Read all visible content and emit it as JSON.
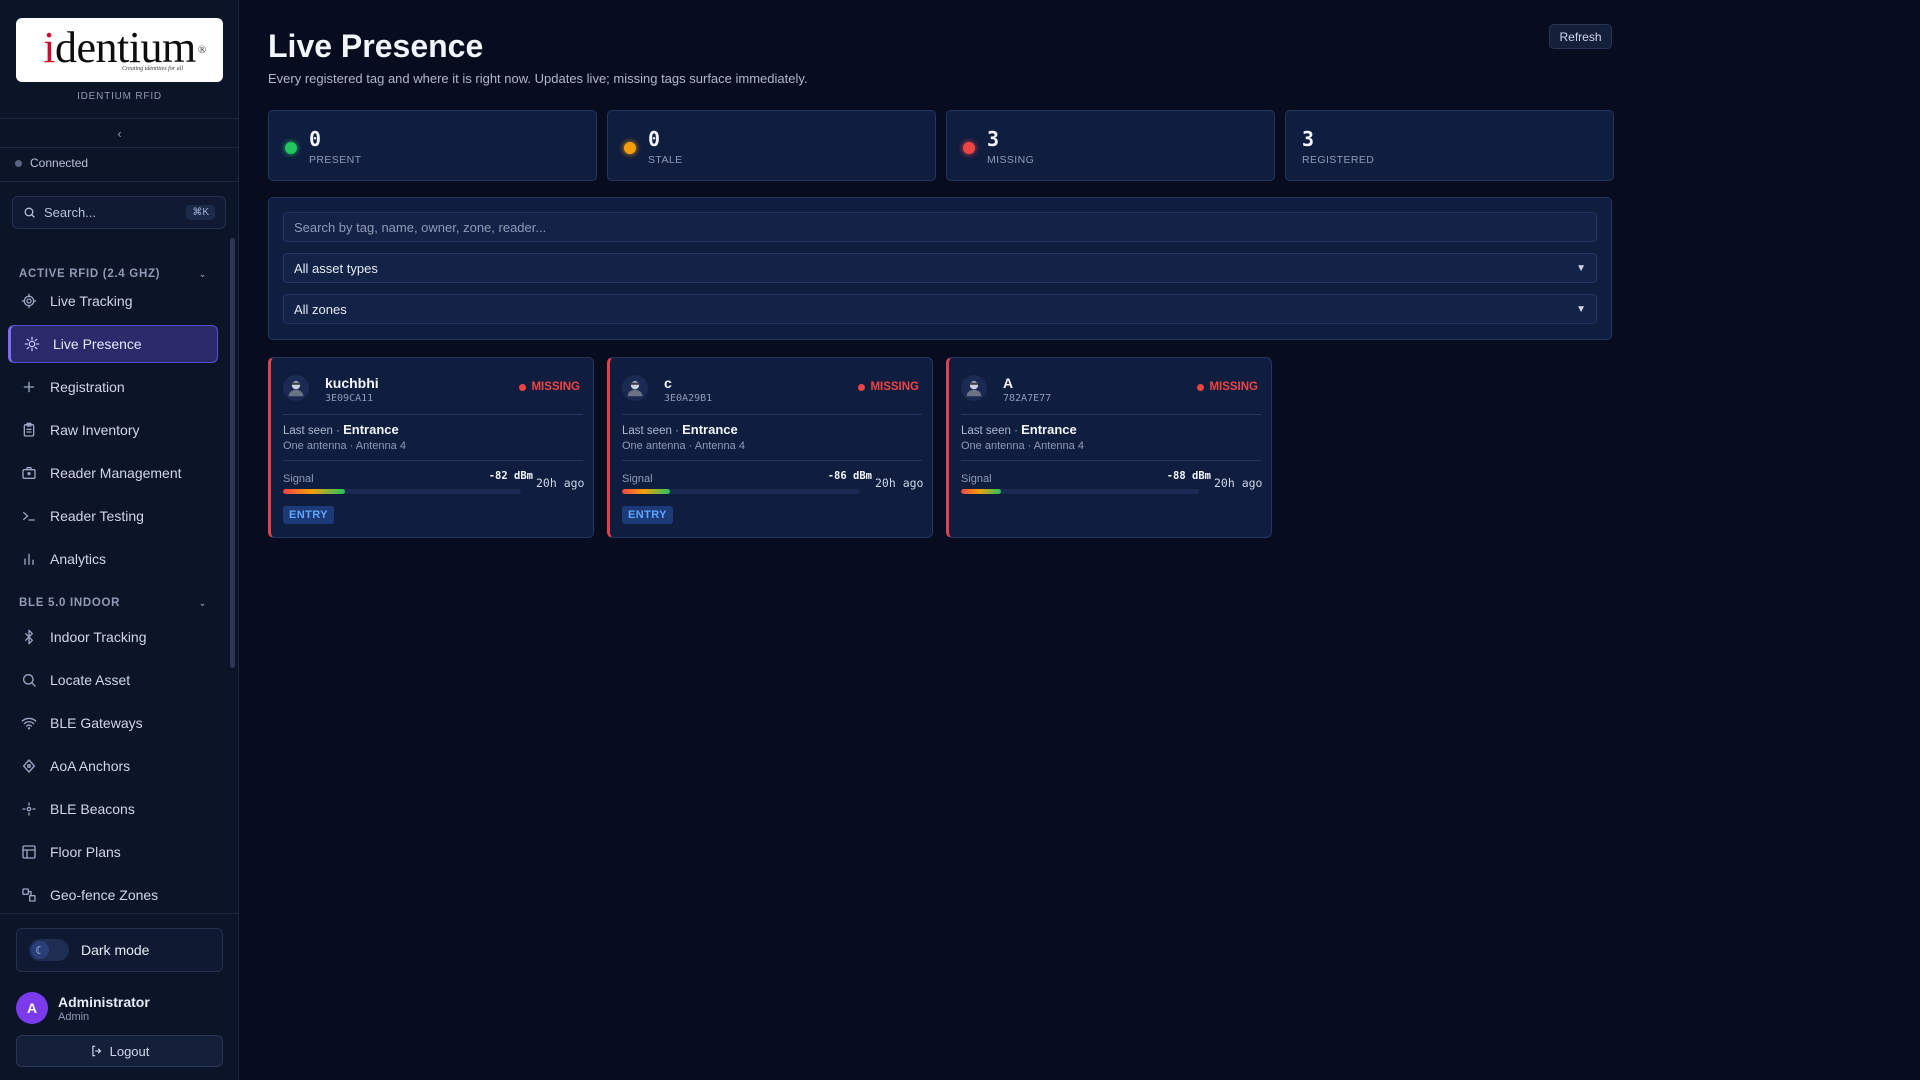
{
  "brand": {
    "logo_text_i": "i",
    "logo_text_rest": "dentium",
    "logo_reg": "®",
    "logo_tagline": "Creating identities for all",
    "label": "IDENTIUM RFID"
  },
  "sidebar": {
    "collapse_glyph": "‹",
    "connection_status": "Connected",
    "search": {
      "placeholder": "Search...",
      "shortcut": "⌘K"
    },
    "sections": [
      {
        "title": "ACTIVE RFID (2.4 GHZ)",
        "items": [
          {
            "label": "Live Tracking",
            "icon": "radar-icon",
            "active": false
          },
          {
            "label": "Live Presence",
            "icon": "sun-icon",
            "active": true
          },
          {
            "label": "Registration",
            "icon": "plus-icon",
            "active": false
          },
          {
            "label": "Raw Inventory",
            "icon": "clipboard-icon",
            "active": false
          },
          {
            "label": "Reader Management",
            "icon": "briefcase-icon",
            "active": false
          },
          {
            "label": "Reader Testing",
            "icon": "terminal-icon",
            "active": false
          },
          {
            "label": "Analytics",
            "icon": "bar-chart-icon",
            "active": false
          }
        ]
      },
      {
        "title": "BLE 5.0 INDOOR",
        "items": [
          {
            "label": "Indoor Tracking",
            "icon": "bluetooth-icon",
            "active": false
          },
          {
            "label": "Locate Asset",
            "icon": "search-icon",
            "active": false
          },
          {
            "label": "BLE Gateways",
            "icon": "wifi-icon",
            "active": false
          },
          {
            "label": "AoA Anchors",
            "icon": "diamond-icon",
            "active": false
          },
          {
            "label": "BLE Beacons",
            "icon": "beacon-icon",
            "active": false
          },
          {
            "label": "Floor Plans",
            "icon": "layout-icon",
            "active": false
          },
          {
            "label": "Geo-fence Zones",
            "icon": "zones-icon",
            "active": false
          }
        ]
      }
    ],
    "dark_mode_label": "Dark mode",
    "user": {
      "initial": "A",
      "name": "Administrator",
      "role": "Admin"
    },
    "logout_label": "Logout"
  },
  "main": {
    "title": "Live Presence",
    "subtitle": "Every registered tag and where it is right now. Updates live; missing tags surface immediately.",
    "refresh_label": "Refresh",
    "stats": [
      {
        "value": "0",
        "label": "PRESENT",
        "color": "#22c55e"
      },
      {
        "value": "0",
        "label": "STALE",
        "color": "#f59e0b"
      },
      {
        "value": "3",
        "label": "MISSING",
        "color": "#ef4444"
      },
      {
        "value": "3",
        "label": "REGISTERED",
        "color": ""
      }
    ],
    "filters": {
      "search_placeholder": "Search by tag, name, owner, zone, reader...",
      "asset_type": "All asset types",
      "zone": "All zones"
    },
    "tags": [
      {
        "name": "kuchbhi",
        "tag_id": "3E09CA11",
        "status": "MISSING",
        "last_seen_prefix": "Last seen · ",
        "zone": "Entrance",
        "antenna": "One antenna · Antenna 4",
        "signal_label": "Signal",
        "signal_dbm": "-82 dBm",
        "signal_strength": 0.26,
        "ago": "20h ago",
        "badge": "ENTRY"
      },
      {
        "name": "c",
        "tag_id": "3E0A29B1",
        "status": "MISSING",
        "last_seen_prefix": "Last seen · ",
        "zone": "Entrance",
        "antenna": "One antenna · Antenna 4",
        "signal_label": "Signal",
        "signal_dbm": "-86 dBm",
        "signal_strength": 0.2,
        "ago": "20h ago",
        "badge": "ENTRY"
      },
      {
        "name": "A",
        "tag_id": "782A7E77",
        "status": "MISSING",
        "last_seen_prefix": "Last seen · ",
        "zone": "Entrance",
        "antenna": "One antenna · Antenna 4",
        "signal_label": "Signal",
        "signal_dbm": "-88 dBm",
        "signal_strength": 0.17,
        "ago": "20h ago",
        "badge": ""
      }
    ]
  }
}
